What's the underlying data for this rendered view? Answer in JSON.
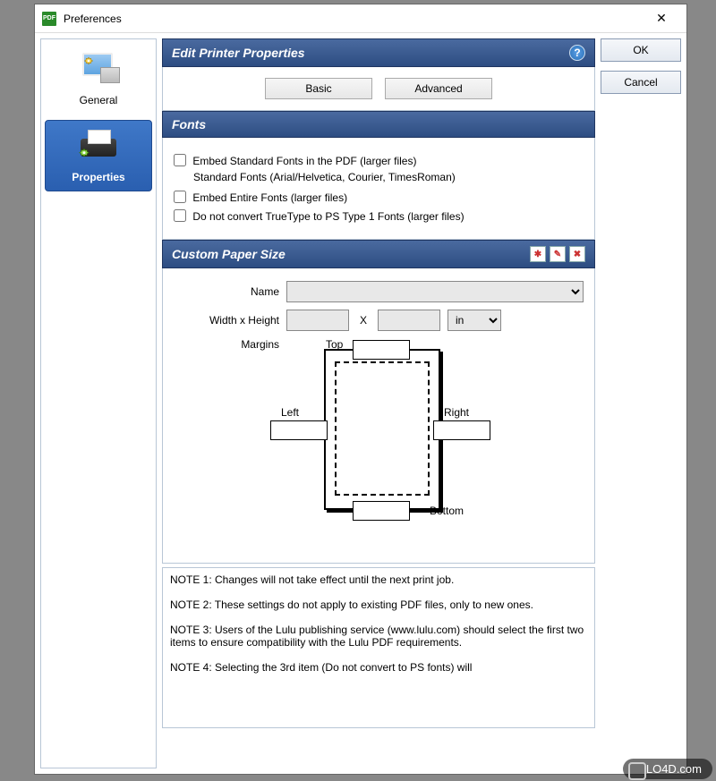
{
  "window": {
    "title": "Preferences"
  },
  "sidebar": {
    "items": [
      {
        "label": "General"
      },
      {
        "label": "Properties"
      }
    ]
  },
  "header": {
    "title": "Edit Printer Properties"
  },
  "tabs": {
    "basic": "Basic",
    "advanced": "Advanced"
  },
  "fonts": {
    "heading": "Fonts",
    "embed_standard": "Embed Standard Fonts in the PDF (larger files)",
    "standard_note": "Standard Fonts (Arial/Helvetica, Courier, TimesRoman)",
    "embed_entire": "Embed Entire Fonts (larger files)",
    "no_convert": "Do not convert TrueType to PS Type 1 Fonts (larger files)"
  },
  "paper": {
    "heading": "Custom Paper Size",
    "name_label": "Name",
    "name_value": "",
    "wh_label": "Width x Height",
    "width": "",
    "height": "",
    "x": "X",
    "unit": "in",
    "margins_label": "Margins",
    "top": "Top",
    "bottom": "Bottom",
    "left": "Left",
    "right": "Right"
  },
  "notes": {
    "n1": "NOTE 1: Changes will not take effect until the next print job.",
    "n2": "NOTE 2: These settings do not apply to existing PDF files, only to new ones.",
    "n3": "NOTE 3: Users of the Lulu publishing service (www.lulu.com) should select the first two items to ensure compatibility with the Lulu PDF requirements.",
    "n4": "NOTE 4: Selecting the 3rd item (Do not convert to PS fonts) will"
  },
  "buttons": {
    "ok": "OK",
    "cancel": "Cancel"
  },
  "watermark": "LO4D.com",
  "icons": {
    "app": "PDF",
    "help": "?",
    "new_doc": "✱",
    "edit_doc": "✎",
    "del_doc": "✖"
  }
}
